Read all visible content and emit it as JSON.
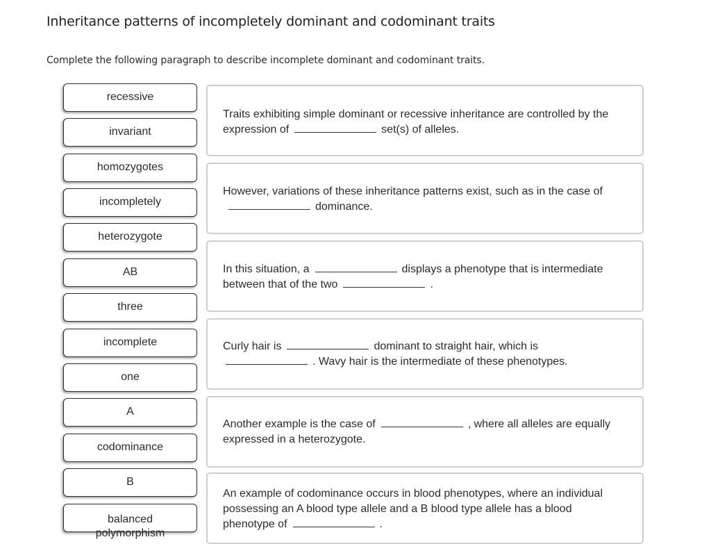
{
  "header": {
    "title": "Inheritance patterns of incompletely dominant and codominant traits",
    "instructions": "Complete the following paragraph to describe incomplete dominant and codominant traits."
  },
  "word_bank": [
    {
      "label": "recessive"
    },
    {
      "label": "invariant"
    },
    {
      "label": "homozygotes"
    },
    {
      "label": "incompletely"
    },
    {
      "label": "heterozygote"
    },
    {
      "label": "AB"
    },
    {
      "label": "three"
    },
    {
      "label": "incomplete"
    },
    {
      "label": "one"
    },
    {
      "label": "A"
    },
    {
      "label": "codominance"
    },
    {
      "label": "B"
    },
    {
      "label": "balanced polymorphism"
    }
  ],
  "sentences": [
    {
      "parts": [
        "Traits exhibiting simple dominant or recessive inheritance are controlled by the expression of",
        "set(s) of alleles."
      ]
    },
    {
      "parts": [
        "However, variations of these inheritance patterns exist, such as in the case of",
        "dominance."
      ]
    },
    {
      "parts": [
        "In this situation, a",
        "displays a phenotype that is intermediate between that of the two",
        "."
      ]
    },
    {
      "parts": [
        "Curly hair is",
        "dominant to straight hair, which is",
        ". Wavy hair is the intermediate of these phenotypes."
      ]
    },
    {
      "parts": [
        "Another example is the case of",
        ", where all alleles are equally expressed in a heterozygote."
      ]
    },
    {
      "parts": [
        "An example of codominance occurs in blood phenotypes, where an individual possessing an A blood type allele and a B blood type allele has a blood phenotype of",
        "."
      ]
    }
  ]
}
